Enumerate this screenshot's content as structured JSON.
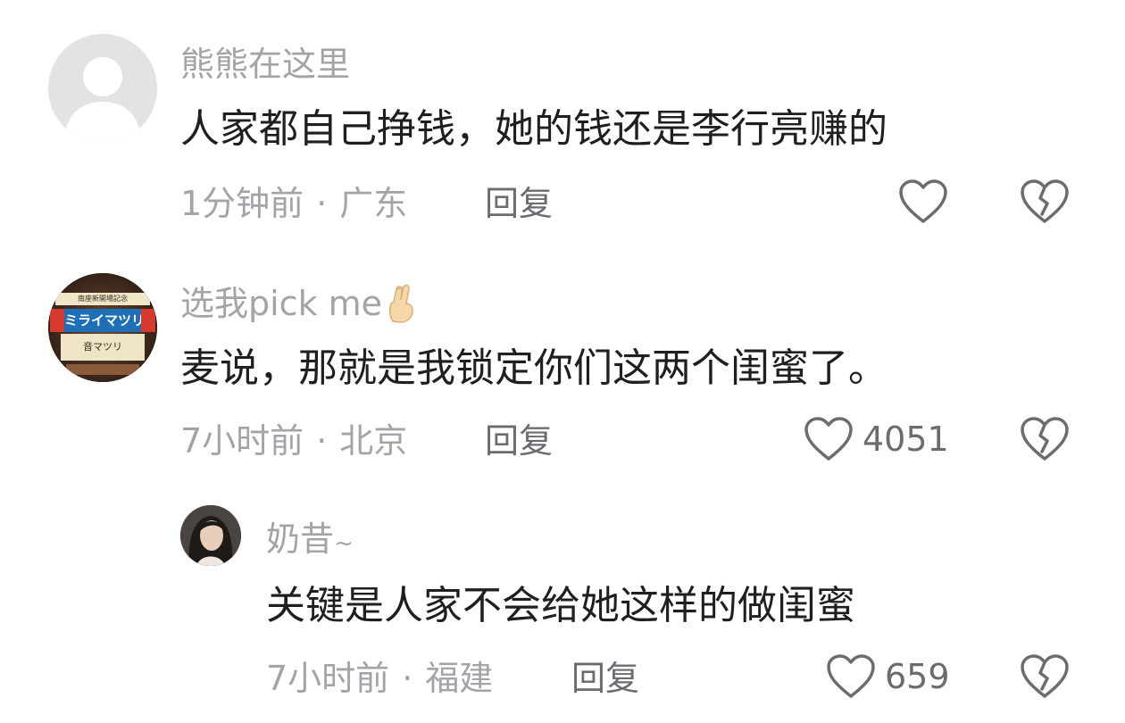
{
  "comments": [
    {
      "username": "熊熊在这里",
      "content": "人家都自己挣钱，她的钱还是李行亮赚的",
      "time": "1分钟前",
      "location": "广东",
      "dot": "·",
      "reply_label": "回复",
      "like_count": "",
      "avatar": "default-avatar"
    },
    {
      "username": "选我pick me",
      "username_emoji": "crossed-fingers-icon",
      "content": "麦说，那就是我锁定你们这两个闺蜜了。",
      "time": "7小时前",
      "location": "北京",
      "dot": "·",
      "reply_label": "回复",
      "like_count": "4051",
      "avatar": "poster-avatar",
      "avatar_text_top": "南座新開場記念",
      "avatar_text_mid": "ミライマツリ",
      "avatar_text_bottom": "音マツリ"
    },
    {
      "username": "奶昔",
      "username_suffix": "~",
      "content": "关键是人家不会给她这样的做闺蜜",
      "time": "7小时前",
      "location": "福建",
      "dot": "·",
      "reply_label": "回复",
      "like_count": "659",
      "avatar": "photo-avatar"
    }
  ],
  "colors": {
    "muted": "#a3a4a8",
    "text": "#1f1f1f",
    "action": "#6b6c70"
  }
}
